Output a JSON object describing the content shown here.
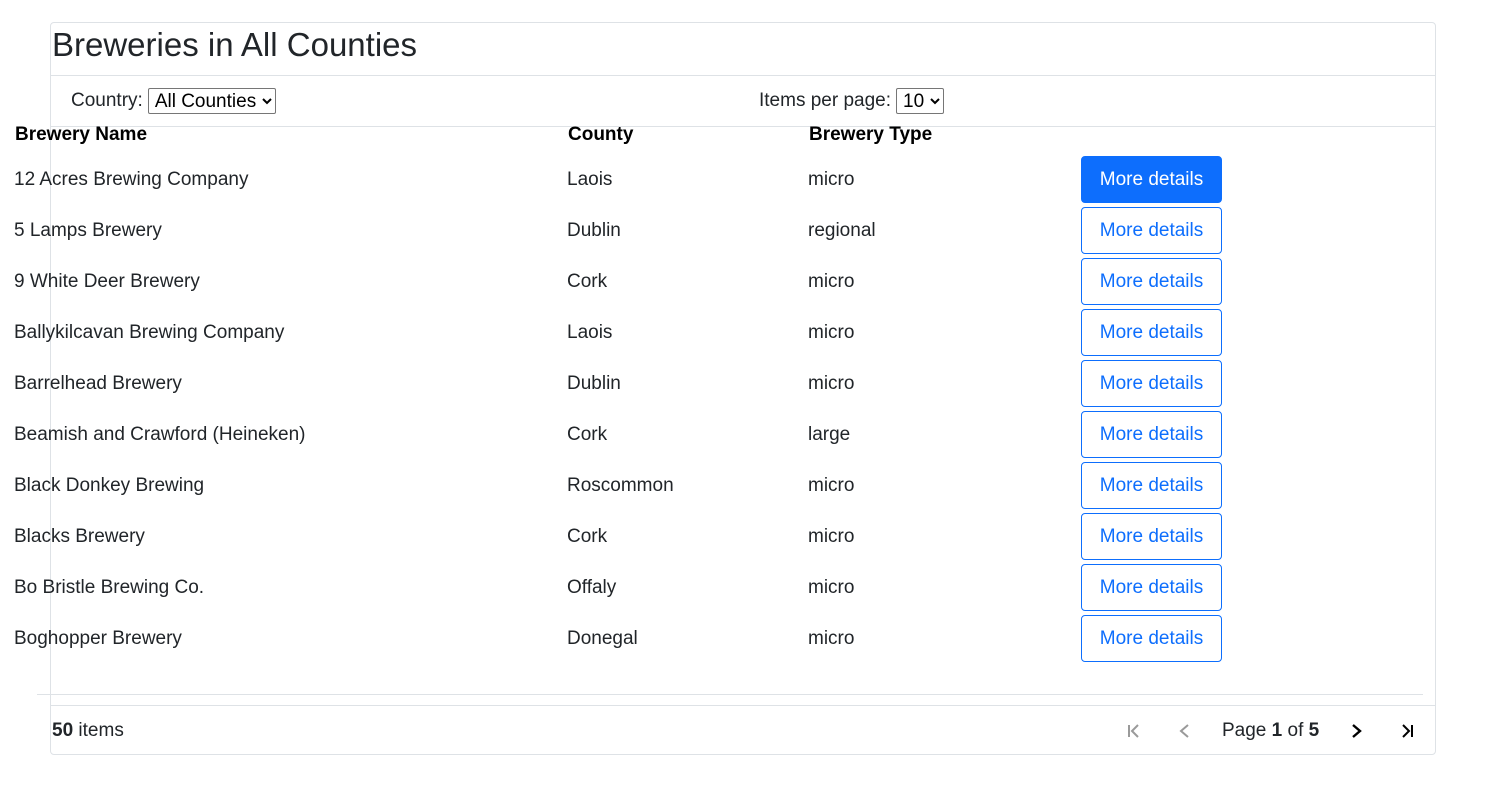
{
  "page": {
    "title": "Breweries in All Counties"
  },
  "filters": {
    "country_label": "Country:",
    "country_selected": "All Counties",
    "per_page_label": "Items per page:",
    "per_page_selected": "10"
  },
  "table": {
    "headers": [
      "Brewery Name",
      "County",
      "Brewery Type",
      ""
    ],
    "button_label": "More details",
    "rows": [
      {
        "name": "12 Acres Brewing Company",
        "county": "Laois",
        "type": "micro"
      },
      {
        "name": "5 Lamps Brewery",
        "county": "Dublin",
        "type": "regional"
      },
      {
        "name": "9 White Deer Brewery",
        "county": "Cork",
        "type": "micro"
      },
      {
        "name": "Ballykilcavan Brewing Company",
        "county": "Laois",
        "type": "micro"
      },
      {
        "name": "Barrelhead Brewery",
        "county": "Dublin",
        "type": "micro"
      },
      {
        "name": "Beamish and Crawford (Heineken)",
        "county": "Cork",
        "type": "large"
      },
      {
        "name": "Black Donkey Brewing",
        "county": "Roscommon",
        "type": "micro"
      },
      {
        "name": "Blacks Brewery",
        "county": "Cork",
        "type": "micro"
      },
      {
        "name": "Bo Bristle Brewing Co.",
        "county": "Offaly",
        "type": "micro"
      },
      {
        "name": "Boghopper Brewery",
        "county": "Donegal",
        "type": "micro"
      }
    ]
  },
  "footer": {
    "item_count": "50",
    "items_word": " items",
    "page_word": "Page ",
    "current_page": "1",
    "of_word": " of ",
    "total_pages": "5"
  },
  "icons": {
    "first": "first-page-icon",
    "prev": "previous-page-icon",
    "next": "next-page-icon",
    "last": "last-page-icon"
  },
  "colors": {
    "primary": "#0d6efd",
    "border": "#dee2e6",
    "disabled": "#9a9a9a"
  }
}
